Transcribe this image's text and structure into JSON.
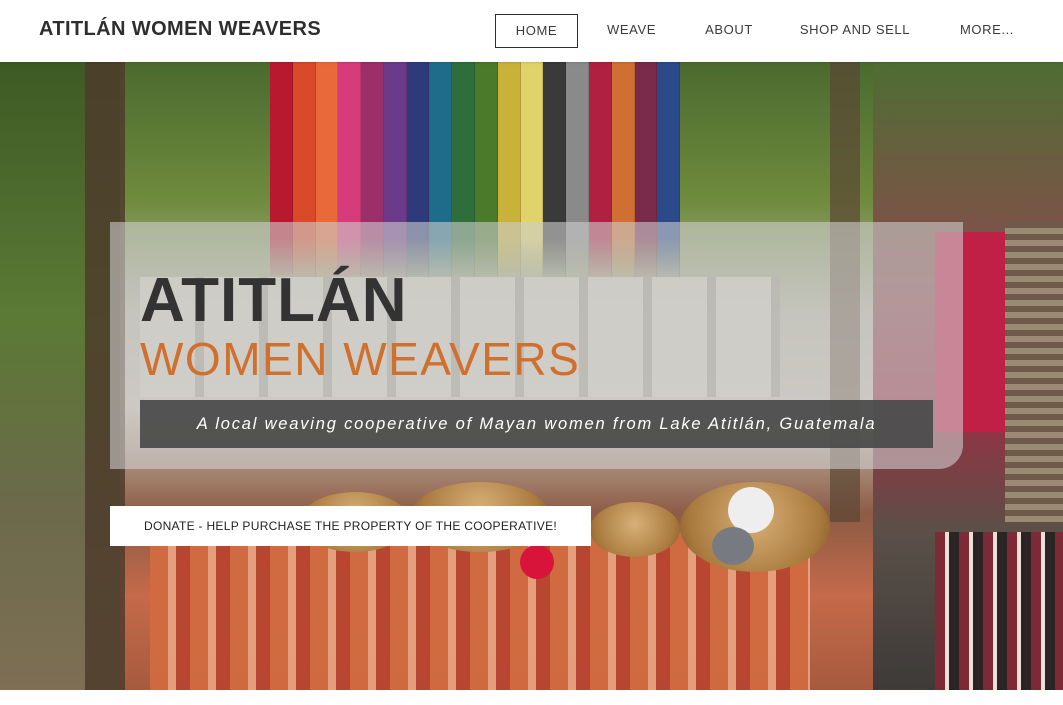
{
  "header": {
    "site_title": "ATITLÁN WOMEN WEAVERS",
    "nav": [
      {
        "label": "HOME",
        "active": true
      },
      {
        "label": "WEAVE",
        "active": false
      },
      {
        "label": "ABOUT",
        "active": false
      },
      {
        "label": "SHOP AND SELL",
        "active": false
      },
      {
        "label": "MORE...",
        "active": false
      }
    ]
  },
  "hero": {
    "title_line1": "ATITLÁN",
    "title_line2": "WOMEN WEAVERS",
    "tagline": "A local weaving cooperative of Mayan women from Lake Atitlán, Guatemala",
    "donate_button": "DONATE - HELP PURCHASE THE PROPERTY OF THE COOPERATIVE!",
    "background_image": "photo-of-colorful-yarn-baskets-and-woven-textiles"
  },
  "colors": {
    "accent_orange": "#d0702e",
    "title_dark": "#333333",
    "tagline_bg": "#4a4a4a",
    "yarn": [
      "#b8192e",
      "#d94a2a",
      "#e86a3a",
      "#d63c79",
      "#9b2f6a",
      "#6b3a8a",
      "#2e3a7a",
      "#1f6c8a",
      "#2f6e3a",
      "#4a7a2a",
      "#c9b23a",
      "#e0d36a",
      "#3a3a3a",
      "#8a8a8a",
      "#b02040",
      "#d07030",
      "#7a2a4a",
      "#2a4a8a"
    ]
  }
}
